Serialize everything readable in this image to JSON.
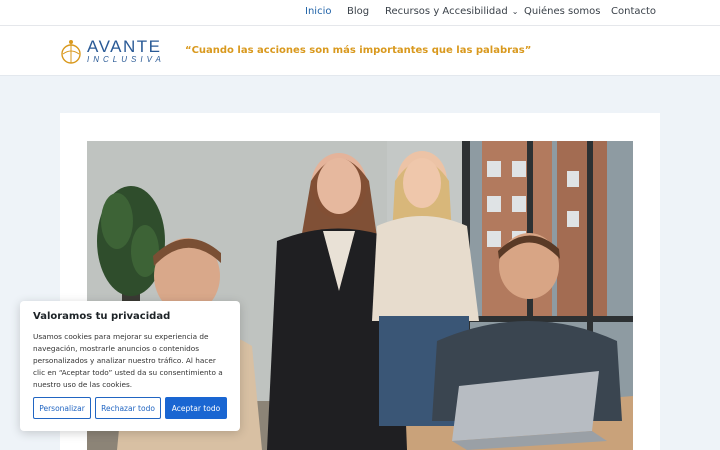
{
  "nav": {
    "items": [
      {
        "label": "Inicio",
        "active": true
      },
      {
        "label": "Blog"
      },
      {
        "label": "Recursos y Accesibilidad",
        "has_dropdown": true
      },
      {
        "label": "Quiénes somos"
      },
      {
        "label": "Contacto"
      }
    ]
  },
  "header": {
    "logo_main": "AVANTE",
    "logo_sub": "INCLUSIVA",
    "tagline": "“Cuando las acciones son más importantes que las palabras”"
  },
  "hero": {
    "image_icon": "team-photo"
  },
  "cookie": {
    "title": "Valoramos tu privacidad",
    "text": "Usamos cookies para mejorar su experiencia de navegación, mostrarle anuncios o contenidos personalizados y analizar nuestro tráfico. Al hacer clic en “Aceptar todo” usted da su consentimiento a nuestro uso de las cookies.",
    "btn_customize": "Personalizar",
    "btn_reject": "Rechazar todo",
    "btn_accept": "Aceptar todo"
  },
  "colors": {
    "accent": "#2163a8",
    "tagline": "#d9991e",
    "button": "#1a66d2",
    "background": "#eef3f8"
  }
}
